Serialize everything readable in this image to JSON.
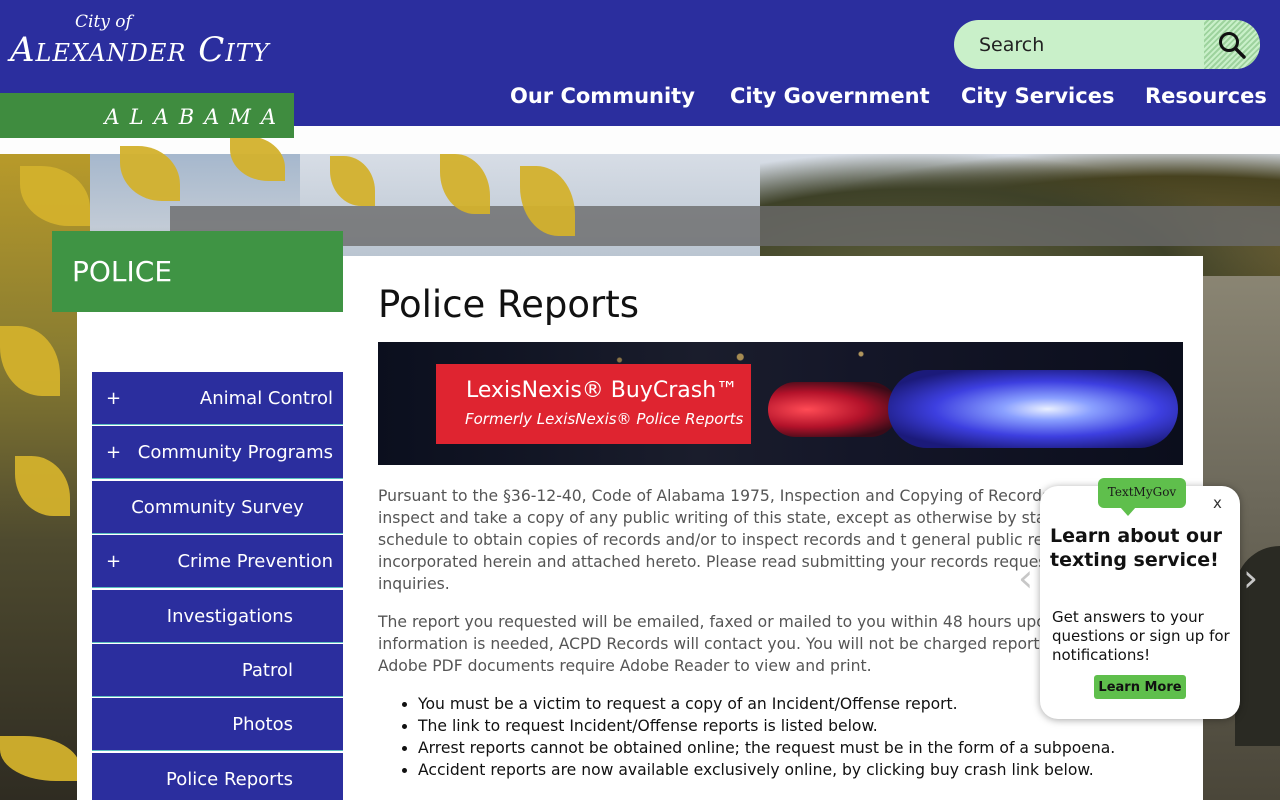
{
  "logo": {
    "city_of": "City of",
    "name": "Alexander City",
    "state": "ALABAMA"
  },
  "search": {
    "placeholder": "Search"
  },
  "nav": {
    "items": [
      "Our Community",
      "City Government",
      "City Services",
      "Resources"
    ]
  },
  "sidebar": {
    "title": "POLICE",
    "items": [
      {
        "label": "Animal Control",
        "expandable": "+"
      },
      {
        "label": "Community Programs",
        "expandable": "+"
      },
      {
        "label": "Community Survey",
        "expandable": ""
      },
      {
        "label": "Crime Prevention",
        "expandable": "+"
      },
      {
        "label": "Investigations",
        "expandable": ""
      },
      {
        "label": "Patrol",
        "expandable": ""
      },
      {
        "label": "Photos",
        "expandable": ""
      },
      {
        "label": "Police Reports",
        "expandable": ""
      }
    ]
  },
  "main": {
    "title": "Police Reports",
    "banner": {
      "title": "LexisNexis® BuyCrash™",
      "subtitle": "Formerly LexisNexis® Police Reports"
    },
    "paragraphs": [
      "Pursuant to the §36-12-40, Code of Alabama 1975, Inspection and Copying of Records, \" a right to inspect and take a copy of any public writing of this state, except as otherwise by statute.\" The fee schedule to obtain copies of records and/or to inspect records and t general public records policy are incorporated herein and attached hereto. Please read submitting your records requests or making inquiries.",
      "The report you requested will be emailed, faxed or mailed to you within 48 hours upon additional information is needed, ACPD Records will contact you. You will not be charged report is unavailable. Adobe PDF documents require Adobe Reader to view and print."
    ],
    "bullets": [
      "You must be a victim to request a copy of an Incident/Offense report.",
      "The link to request Incident/Offense reports is listed below.",
      "Arrest reports cannot be obtained online; the request must be in the form of a subpoena.",
      "Accident reports are now available exclusively online, by clicking buy crash link below."
    ]
  },
  "popup": {
    "badge": "TextMyGov",
    "close": "x",
    "heading": "Learn about our texting service!",
    "body": "Get answers to your questions or sign up for notifications!",
    "button": "Learn More"
  },
  "carousel": {
    "prev": "‹",
    "next": "›"
  },
  "colors": {
    "header_blue": "#2b2e9e",
    "brand_green": "#3f9444",
    "popup_green": "#5fbf4c"
  }
}
